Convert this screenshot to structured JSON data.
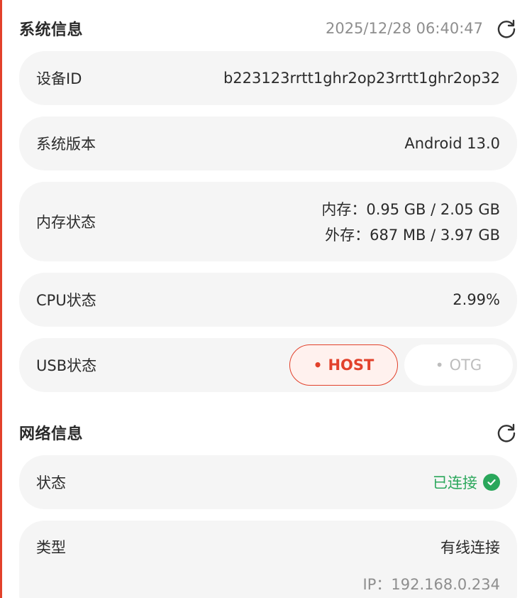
{
  "system": {
    "title": "系统信息",
    "timestamp": "2025/12/28 06:40:47",
    "device_id_label": "设备ID",
    "device_id_value": "b223123rrtt1ghr2op23rrtt1ghr2op32",
    "version_label": "系统版本",
    "version_value": "Android 13.0",
    "memory_label": "内存状态",
    "memory_internal": "内存：0.95 GB / 2.05 GB",
    "memory_external": "外存：687 MB / 3.97 GB",
    "cpu_label": "CPU状态",
    "cpu_value": "2.99%",
    "usb_label": "USB状态",
    "usb_options": [
      "HOST",
      "OTG"
    ],
    "usb_selected": "HOST"
  },
  "network": {
    "title": "网络信息",
    "status_label": "状态",
    "status_value": "已连接",
    "type_label": "类型",
    "type_value": "有线连接",
    "ip_text": "IP：192.168.0.234"
  },
  "colors": {
    "accent": "#e2412b",
    "success": "#2aa75b",
    "row_bg": "#f5f5f5",
    "muted_text": "#8e8e8e"
  },
  "icons": {
    "refresh": "refresh-icon",
    "check": "check-circle-icon",
    "dot": "dot-icon"
  }
}
